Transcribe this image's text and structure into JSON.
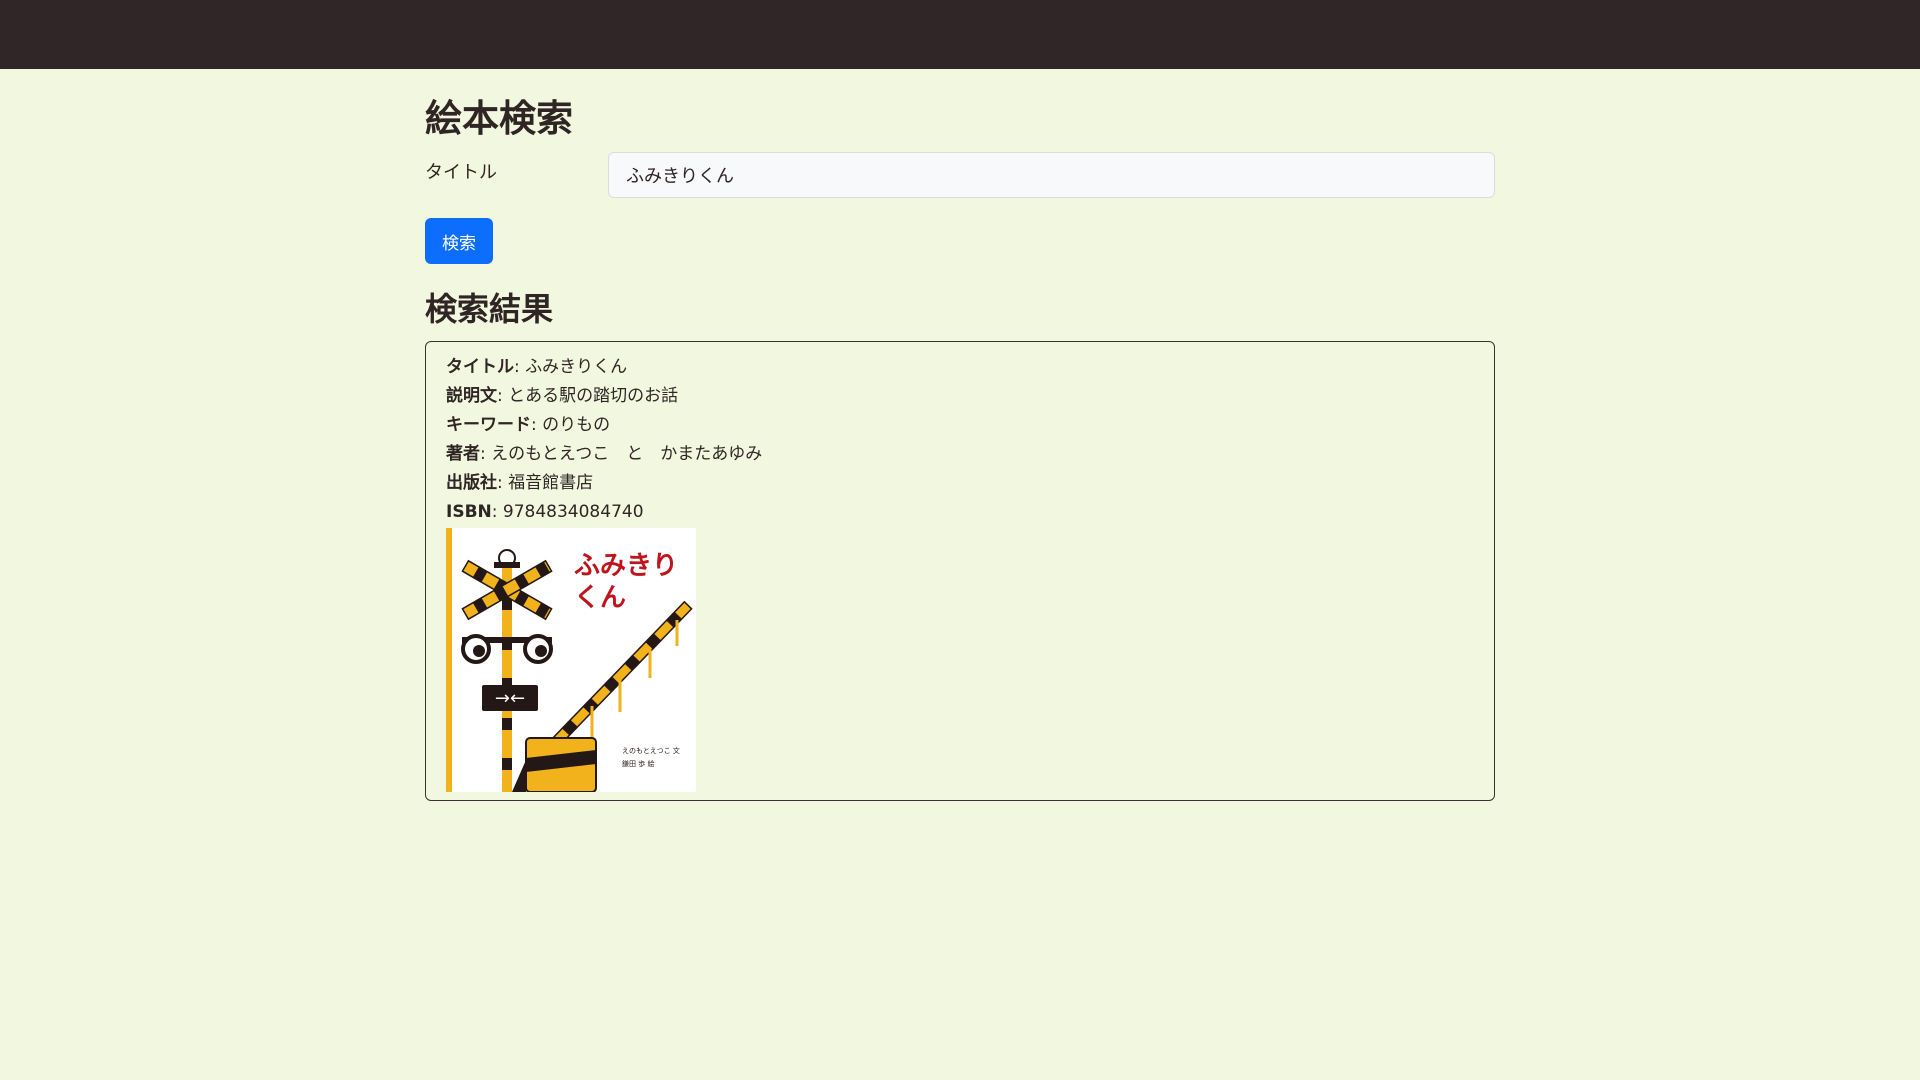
{
  "header": {},
  "page": {
    "title": "絵本検索"
  },
  "search_form": {
    "title_label": "タイトル",
    "title_value": "ふみきりくん",
    "submit_label": "検索"
  },
  "results": {
    "heading": "検索結果",
    "items": [
      {
        "title_key": "タイトル",
        "title": "ふみきりくん",
        "description_key": "説明文",
        "description": "とある駅の踏切のお話",
        "keyword_key": "キーワード",
        "keyword": "のりもの",
        "author_key": "著者",
        "author": "えのもとえつこ　と　かまたあゆみ",
        "publisher_key": "出版社",
        "publisher": "福音館書店",
        "isbn_key": "ISBN",
        "isbn": "9784834084740",
        "cover": {
          "title_line1": "ふみきり",
          "title_line2": "くん",
          "credit_line1": "えのもとえつこ  文",
          "credit_line2": "鎌田 歩  絵",
          "title_color": "#c0141c",
          "accent_color": "#f2b21c"
        }
      }
    ]
  }
}
